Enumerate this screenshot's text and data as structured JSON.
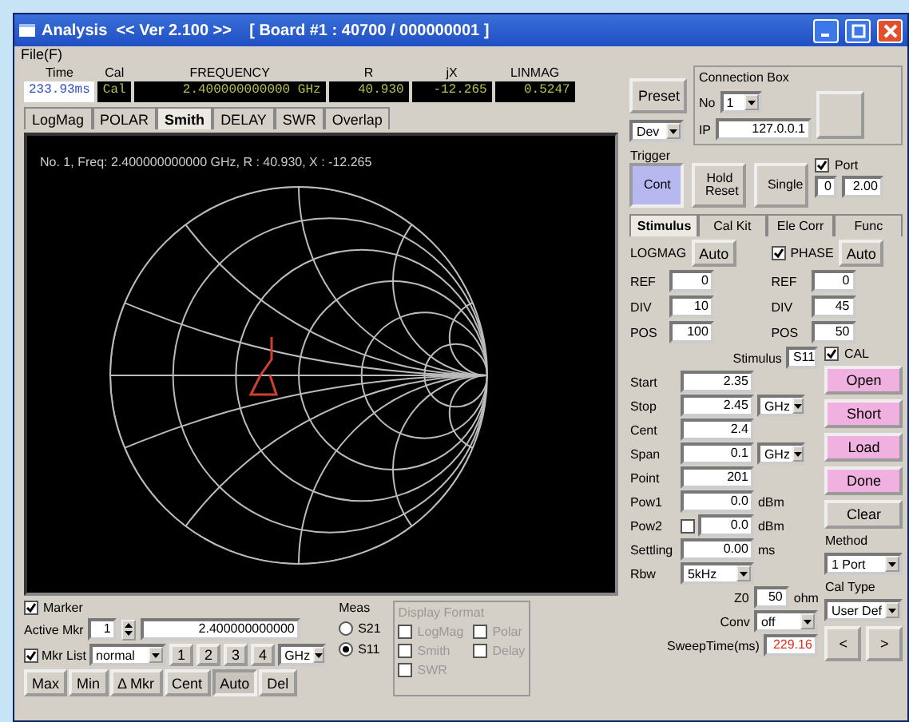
{
  "window": {
    "title": "Analysis  << Ver 2.100 >>    [ Board #1 : 40700 / 000000001 ]"
  },
  "menu": [
    "File(F)"
  ],
  "readouts": [
    {
      "label": "Time",
      "value": "233.93ms",
      "kind": "light"
    },
    {
      "label": "Cal",
      "value": "Cal",
      "kind": "dark"
    },
    {
      "label": "FREQUENCY",
      "value": "2.400000000000 GHz",
      "kind": "dark"
    },
    {
      "label": "R",
      "value": "40.930",
      "kind": "dark"
    },
    {
      "label": "jX",
      "value": "-12.265",
      "kind": "dark"
    },
    {
      "label": "LINMAG",
      "value": "0.5247",
      "kind": "dark"
    }
  ],
  "display_tabs": [
    {
      "label": "LogMag",
      "selected": false
    },
    {
      "label": "POLAR",
      "selected": false
    },
    {
      "label": "Smith",
      "selected": true
    },
    {
      "label": "DELAY",
      "selected": false
    },
    {
      "label": "SWR",
      "selected": false
    },
    {
      "label": "Overlap",
      "selected": false
    }
  ],
  "chart": {
    "marker_info": "No. 1, Freq: 2.400000000000 GHz, R : 40.930, X : -12.265"
  },
  "preset": {
    "button": "Preset",
    "device": "Dev"
  },
  "connection_box": {
    "title": "Connection Box",
    "no_label": "No",
    "no_value": "1",
    "ip_label": "IP",
    "ip_value": "127.0.0.1"
  },
  "trigger": {
    "title": "Trigger",
    "buttons": [
      {
        "label": "Cont",
        "selected": true
      },
      {
        "label": "Hold Reset",
        "selected": false
      },
      {
        "label": "Single",
        "selected": false
      }
    ],
    "port": {
      "label": "Port",
      "checked": true,
      "values": [
        "0",
        "2.00"
      ]
    }
  },
  "settings_tabs": [
    {
      "label": "Stimulus",
      "selected": true
    },
    {
      "label": "Cal Kit",
      "selected": false
    },
    {
      "label": "Ele Corr",
      "selected": false
    },
    {
      "label": "Func",
      "selected": false
    }
  ],
  "scales": [
    {
      "label": "LOGMAG",
      "auto": "Auto",
      "rows": [
        {
          "label": "REF",
          "value": "0"
        },
        {
          "label": "DIV",
          "value": "10"
        },
        {
          "label": "POS",
          "value": "100"
        }
      ]
    },
    {
      "label": "PHASE",
      "checked": true,
      "auto": "Auto",
      "rows": [
        {
          "label": "REF",
          "value": "0"
        },
        {
          "label": "DIV",
          "value": "45"
        },
        {
          "label": "POS",
          "value": "50"
        }
      ]
    }
  ],
  "stimulus": {
    "label": "Stimulus",
    "value": "S11",
    "rows": [
      {
        "label": "Start",
        "value": "2.35",
        "kind": "field"
      },
      {
        "label": "Stop",
        "value": "2.45",
        "kind": "field",
        "unit": "GHz",
        "unit_dropdown": true
      },
      {
        "label": "Cent",
        "value": "2.4",
        "kind": "field"
      },
      {
        "label": "Span",
        "value": "0.1",
        "kind": "field",
        "unit": "GHz",
        "unit_dropdown": true
      },
      {
        "label": "Point",
        "value": "201",
        "kind": "field"
      },
      {
        "label": "Pow1",
        "value": "0.0",
        "kind": "field",
        "unit": "dBm",
        "unit_dropdown": false
      },
      {
        "label": "Pow2",
        "value": "0.0",
        "kind": "check-field",
        "checked": false,
        "unit": "dBm",
        "unit_dropdown": false
      },
      {
        "label": "Settling",
        "value": "0.00",
        "kind": "field",
        "unit": "ms",
        "unit_dropdown": false
      },
      {
        "label": "Rbw",
        "value": "5kHz",
        "kind": "select"
      }
    ]
  },
  "calibration": {
    "cal": {
      "label": "CAL",
      "checked": true
    },
    "buttons": [
      {
        "label": "Open",
        "kind": "step"
      },
      {
        "label": "Short",
        "kind": "step"
      },
      {
        "label": "Load",
        "kind": "step"
      },
      {
        "label": "Done",
        "kind": "step"
      },
      {
        "label": "Clear",
        "kind": "plain"
      }
    ],
    "method_label": "Method",
    "method": "1 Port",
    "cal_type_label": "Cal Type",
    "cal_type": "User Def"
  },
  "z0": {
    "label": "Z0",
    "value": "50",
    "unit": "ohm"
  },
  "conv": {
    "label": "Conv",
    "value": "off"
  },
  "sweep_time": {
    "label": "SweepTime(ms)",
    "value": "229.16"
  },
  "nav_buttons": [
    "<",
    ">"
  ],
  "marker": {
    "label": "Marker",
    "checked": true,
    "active_label": "Active Mkr",
    "active_value": "1",
    "freq_value": "2.400000000000",
    "list_label": "Mkr List",
    "list_checked": true,
    "list_mode": "normal",
    "index_buttons": [
      "1",
      "2",
      "3",
      "4"
    ],
    "unit": "GHz",
    "buttons": [
      {
        "label": "Max",
        "pressed": false
      },
      {
        "label": "Min",
        "pressed": false
      },
      {
        "label": "Δ Mkr",
        "pressed": false
      },
      {
        "label": "Cent",
        "pressed": false
      },
      {
        "label": "Auto",
        "pressed": true
      },
      {
        "label": "Del",
        "pressed": false
      }
    ]
  },
  "meas": {
    "title": "Meas",
    "options": [
      {
        "label": "S21",
        "selected": false
      },
      {
        "label": "S11",
        "selected": true
      }
    ]
  },
  "display_format": {
    "title": "Display Format",
    "options": [
      {
        "label": "LogMag",
        "checked": false,
        "disabled": true
      },
      {
        "label": "Polar",
        "checked": false,
        "disabled": true
      },
      {
        "label": "Smith",
        "checked": false,
        "disabled": true
      },
      {
        "label": "Delay",
        "checked": false,
        "disabled": true
      },
      {
        "label": "SWR",
        "checked": false,
        "disabled": true
      }
    ]
  }
}
